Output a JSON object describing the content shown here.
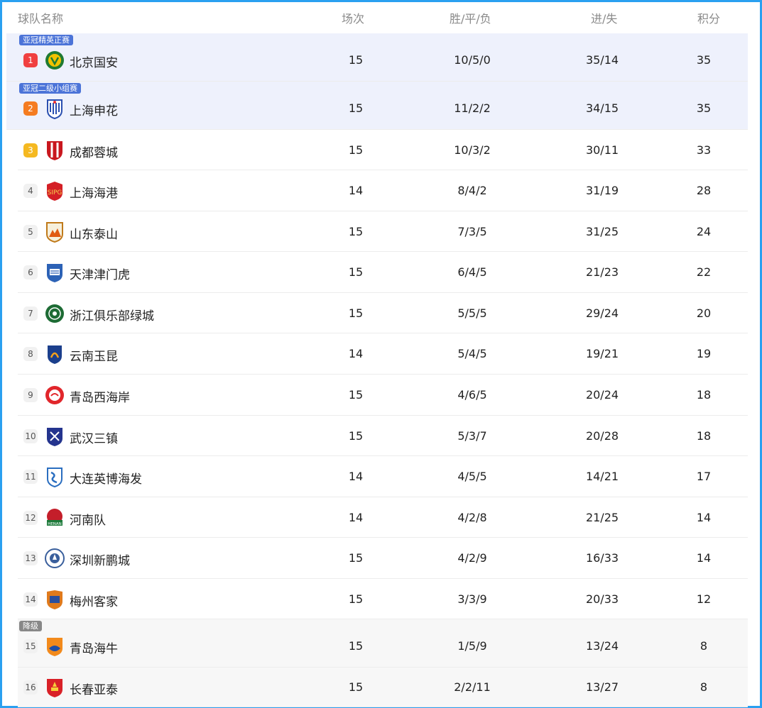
{
  "header": {
    "team": "球队名称",
    "games": "场次",
    "wdl": "胜/平/负",
    "goals": "进/失",
    "points": "积分"
  },
  "zones": {
    "acl_elite": "亚冠精英正赛",
    "acl_two": "亚冠二级小组赛",
    "relegation": "降级"
  },
  "colors": {
    "frame": "#2aa0f0",
    "zone_band": "#eef1fc",
    "zone_tag": "#4c74d8",
    "relegation_tag": "#888888",
    "rank1": "#f04040",
    "rank2": "#f57c20",
    "rank3": "#f5b921"
  },
  "rows": [
    {
      "rank": "1",
      "team": "北京国安",
      "games": "15",
      "wdl": "10/5/0",
      "goals": "35/14",
      "points": "35",
      "logo": "beijing-guoan-logo"
    },
    {
      "rank": "2",
      "team": "上海申花",
      "games": "15",
      "wdl": "11/2/2",
      "goals": "34/15",
      "points": "35",
      "logo": "shanghai-shenhua-logo"
    },
    {
      "rank": "3",
      "team": "成都蓉城",
      "games": "15",
      "wdl": "10/3/2",
      "goals": "30/11",
      "points": "33",
      "logo": "chengdu-rongcheng-logo"
    },
    {
      "rank": "4",
      "team": "上海海港",
      "games": "14",
      "wdl": "8/4/2",
      "goals": "31/19",
      "points": "28",
      "logo": "shanghai-port-logo"
    },
    {
      "rank": "5",
      "team": "山东泰山",
      "games": "15",
      "wdl": "7/3/5",
      "goals": "31/25",
      "points": "24",
      "logo": "shandong-taishan-logo"
    },
    {
      "rank": "6",
      "team": "天津津门虎",
      "games": "15",
      "wdl": "6/4/5",
      "goals": "21/23",
      "points": "22",
      "logo": "tianjin-tiger-logo"
    },
    {
      "rank": "7",
      "team": "浙江俱乐部绿城",
      "games": "15",
      "wdl": "5/5/5",
      "goals": "29/24",
      "points": "20",
      "logo": "zhejiang-greentown-logo"
    },
    {
      "rank": "8",
      "team": "云南玉昆",
      "games": "14",
      "wdl": "5/4/5",
      "goals": "19/21",
      "points": "19",
      "logo": "yunnan-yukun-logo"
    },
    {
      "rank": "9",
      "team": "青岛西海岸",
      "games": "15",
      "wdl": "4/6/5",
      "goals": "20/24",
      "points": "18",
      "logo": "qingdao-west-coast-logo"
    },
    {
      "rank": "10",
      "team": "武汉三镇",
      "games": "15",
      "wdl": "5/3/7",
      "goals": "20/28",
      "points": "18",
      "logo": "wuhan-three-towns-logo"
    },
    {
      "rank": "11",
      "team": "大连英博海发",
      "games": "14",
      "wdl": "4/5/5",
      "goals": "14/21",
      "points": "17",
      "logo": "dalian-yingbo-logo"
    },
    {
      "rank": "12",
      "team": "河南队",
      "games": "14",
      "wdl": "4/2/8",
      "goals": "21/25",
      "points": "14",
      "logo": "henan-logo"
    },
    {
      "rank": "13",
      "team": "深圳新鹏城",
      "games": "15",
      "wdl": "4/2/9",
      "goals": "16/33",
      "points": "14",
      "logo": "shenzhen-peng-city-logo"
    },
    {
      "rank": "14",
      "team": "梅州客家",
      "games": "15",
      "wdl": "3/3/9",
      "goals": "20/33",
      "points": "12",
      "logo": "meizhou-hakka-logo"
    },
    {
      "rank": "15",
      "team": "青岛海牛",
      "games": "15",
      "wdl": "1/5/9",
      "goals": "13/24",
      "points": "8",
      "logo": "qingdao-hainiu-logo"
    },
    {
      "rank": "16",
      "team": "长春亚泰",
      "games": "15",
      "wdl": "2/2/11",
      "goals": "13/27",
      "points": "8",
      "logo": "changchun-yatai-logo"
    }
  ]
}
